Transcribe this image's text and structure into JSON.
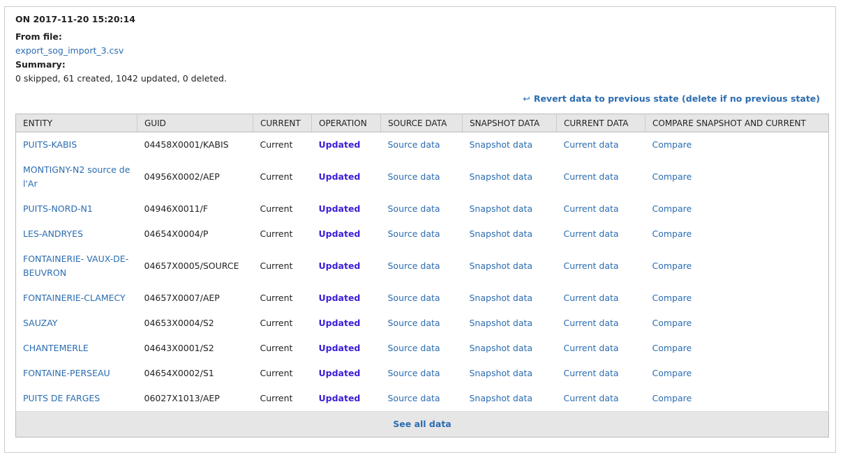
{
  "header": {
    "on_date": "ON 2017-11-20 15:20:14",
    "from_label": "From file:",
    "file_name": "export_sog_import_3.csv",
    "summary_label": "Summary:",
    "summary_text": "0 skipped, 61 created, 1042 updated, 0 deleted."
  },
  "revert": {
    "icon": "revert-arrow-icon",
    "glyph": "↩",
    "label": "Revert data to previous state (delete if no previous state)"
  },
  "table": {
    "columns": [
      "ENTITY",
      "GUID",
      "CURRENT",
      "OPERATION",
      "SOURCE DATA",
      "SNAPSHOT DATA",
      "CURRENT DATA",
      "COMPARE SNAPSHOT AND CURRENT"
    ],
    "rows": [
      {
        "entity": "PUITS-KABIS",
        "guid": "04458X0001/KABIS",
        "current": "Current",
        "operation": "Updated",
        "source": "Source data",
        "snapshot": "Snapshot data",
        "current_data": "Current data",
        "compare": "Compare"
      },
      {
        "entity": "MONTIGNY-N2 source de l'Ar",
        "guid": "04956X0002/AEP",
        "current": "Current",
        "operation": "Updated",
        "source": "Source data",
        "snapshot": "Snapshot data",
        "current_data": "Current data",
        "compare": "Compare"
      },
      {
        "entity": "PUITS-NORD-N1",
        "guid": "04946X0011/F",
        "current": "Current",
        "operation": "Updated",
        "source": "Source data",
        "snapshot": "Snapshot data",
        "current_data": "Current data",
        "compare": "Compare"
      },
      {
        "entity": "LES-ANDRYES",
        "guid": "04654X0004/P",
        "current": "Current",
        "operation": "Updated",
        "source": "Source data",
        "snapshot": "Snapshot data",
        "current_data": "Current data",
        "compare": "Compare"
      },
      {
        "entity": "FONTAINERIE- VAUX-DE-BEUVRON",
        "guid": "04657X0005/SOURCE",
        "current": "Current",
        "operation": "Updated",
        "source": "Source data",
        "snapshot": "Snapshot data",
        "current_data": "Current data",
        "compare": "Compare"
      },
      {
        "entity": "FONTAINERIE-CLAMECY",
        "guid": "04657X0007/AEP",
        "current": "Current",
        "operation": "Updated",
        "source": "Source data",
        "snapshot": "Snapshot data",
        "current_data": "Current data",
        "compare": "Compare"
      },
      {
        "entity": "SAUZAY",
        "guid": "04653X0004/S2",
        "current": "Current",
        "operation": "Updated",
        "source": "Source data",
        "snapshot": "Snapshot data",
        "current_data": "Current data",
        "compare": "Compare"
      },
      {
        "entity": "CHANTEMERLE",
        "guid": "04643X0001/S2",
        "current": "Current",
        "operation": "Updated",
        "source": "Source data",
        "snapshot": "Snapshot data",
        "current_data": "Current data",
        "compare": "Compare"
      },
      {
        "entity": "FONTAINE-PERSEAU",
        "guid": "04654X0002/S1",
        "current": "Current",
        "operation": "Updated",
        "source": "Source data",
        "snapshot": "Snapshot data",
        "current_data": "Current data",
        "compare": "Compare"
      },
      {
        "entity": "PUITS DE FARGES",
        "guid": "06027X1013/AEP",
        "current": "Current",
        "operation": "Updated",
        "source": "Source data",
        "snapshot": "Snapshot data",
        "current_data": "Current data",
        "compare": "Compare"
      }
    ],
    "footer_link": "See all data"
  },
  "colors": {
    "link": "#2b6cb0",
    "operation": "#3a1fd6",
    "header_bg": "#e6e6e6"
  }
}
